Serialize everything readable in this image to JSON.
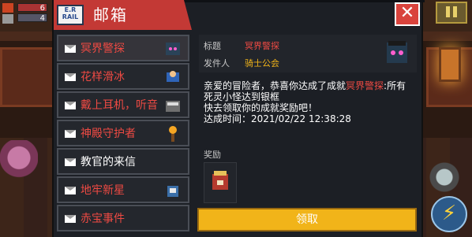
{
  "hud": {
    "hp_value": "6",
    "armor_value": "4"
  },
  "mailbox": {
    "title": "邮箱",
    "icon_text": "E.R RAIL",
    "items": [
      {
        "label": "冥界警探",
        "color": "red",
        "selected": true
      },
      {
        "label": "花样滑冰",
        "color": "red",
        "selected": false
      },
      {
        "label": "戴上耳机，听音",
        "color": "red",
        "selected": false
      },
      {
        "label": "神殿守护者",
        "color": "red",
        "selected": false
      },
      {
        "label": "教官的来信",
        "color": "white",
        "selected": false
      },
      {
        "label": "地牢新星",
        "color": "red",
        "selected": false
      },
      {
        "label": "赤宝事件",
        "color": "red",
        "selected": false
      }
    ]
  },
  "detail": {
    "title_key": "标题",
    "title_value": "冥界警探",
    "sender_key": "发件人",
    "sender_value": "骑士公会",
    "body_pre": "亲爱的冒险者，恭喜你达成了成就",
    "body_achievement": "冥界警探",
    "body_post": ":所有死灵小怪达到银框",
    "body_line2": "快去领取你的成就奖励吧！",
    "time_label": "达成时间：",
    "time_value": "2021/02/22 12:38:28",
    "reward_label": "奖励",
    "claim_label": "领取"
  },
  "colors": {
    "accent_red": "#c33935",
    "claim_gold": "#f1b419",
    "highlight_red": "#ee4a43",
    "sender_gold": "#f1b419"
  }
}
